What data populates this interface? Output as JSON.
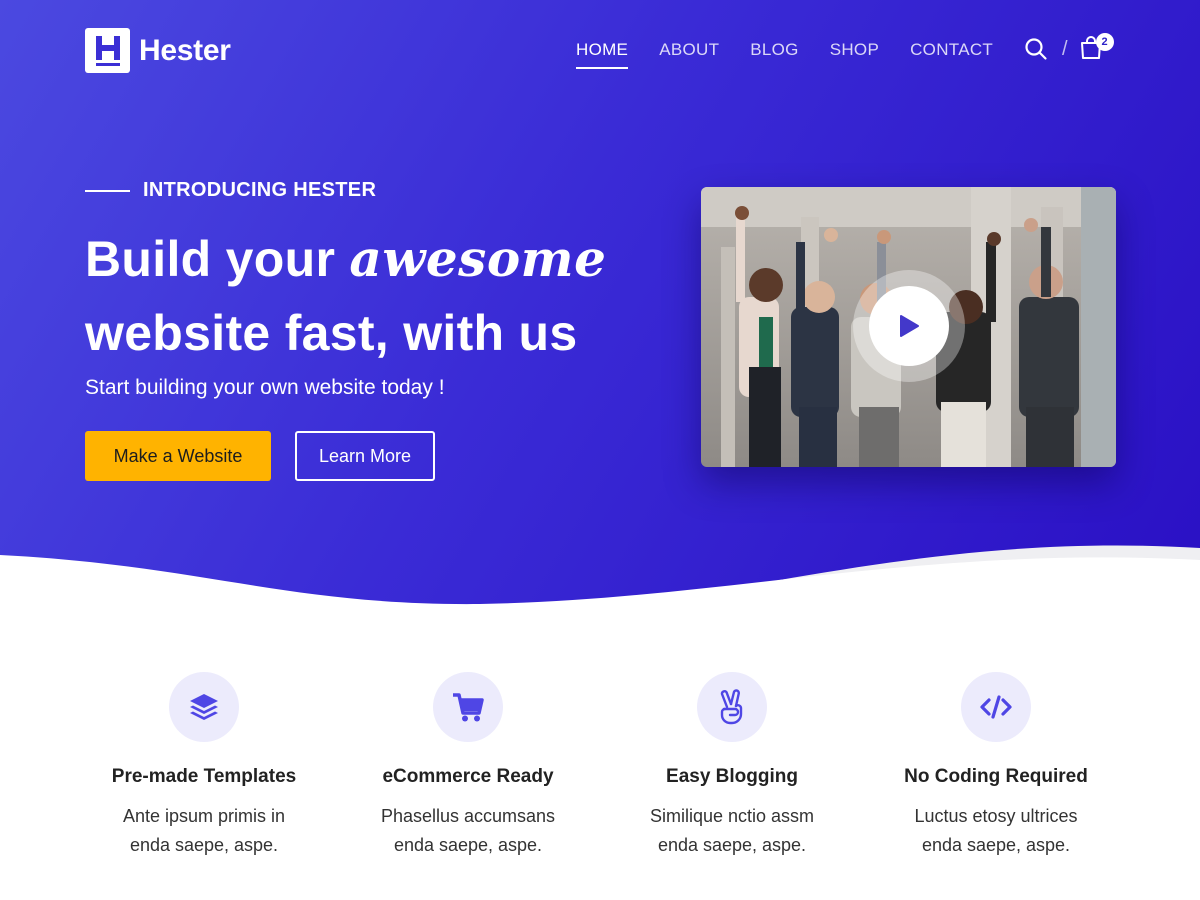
{
  "brand": {
    "name": "Hester",
    "logo_letter": "H"
  },
  "nav": {
    "items": [
      {
        "label": "HOME",
        "active": true
      },
      {
        "label": "ABOUT",
        "active": false
      },
      {
        "label": "BLOG",
        "active": false
      },
      {
        "label": "SHOP",
        "active": false
      },
      {
        "label": "CONTACT",
        "active": false
      }
    ],
    "separator": "/",
    "cart_count": "2"
  },
  "hero": {
    "eyebrow": "INTRODUCING HESTER",
    "headline_line1_start": "Build your ",
    "headline_accent": "awesome",
    "headline_line2": "website fast, with us",
    "subheadline": "Start building your own website today !",
    "primary_button": "Make a Website",
    "secondary_button": "Learn More"
  },
  "features": [
    {
      "icon": "layers-icon",
      "title": "Pre-made Templates",
      "desc_line1": "Ante ipsum primis in",
      "desc_line2": "enda saepe, aspe."
    },
    {
      "icon": "shopping-cart-icon",
      "title": "eCommerce Ready",
      "desc_line1": "Phasellus accumsans",
      "desc_line2": "enda saepe, aspe."
    },
    {
      "icon": "peace-hand-icon",
      "title": "Easy Blogging",
      "desc_line1": "Similique nctio assm",
      "desc_line2": "enda saepe, aspe."
    },
    {
      "icon": "code-icon",
      "title": "No Coding Required",
      "desc_line1": "Luctus etosy ultrices",
      "desc_line2": "enda saepe, aspe."
    }
  ],
  "colors": {
    "hero_gradient_start": "#4b49e0",
    "hero_gradient_end": "#2a10c4",
    "accent_yellow": "#ffb300",
    "icon_purple": "#4f46e5",
    "icon_bg": "#ecebfc"
  }
}
